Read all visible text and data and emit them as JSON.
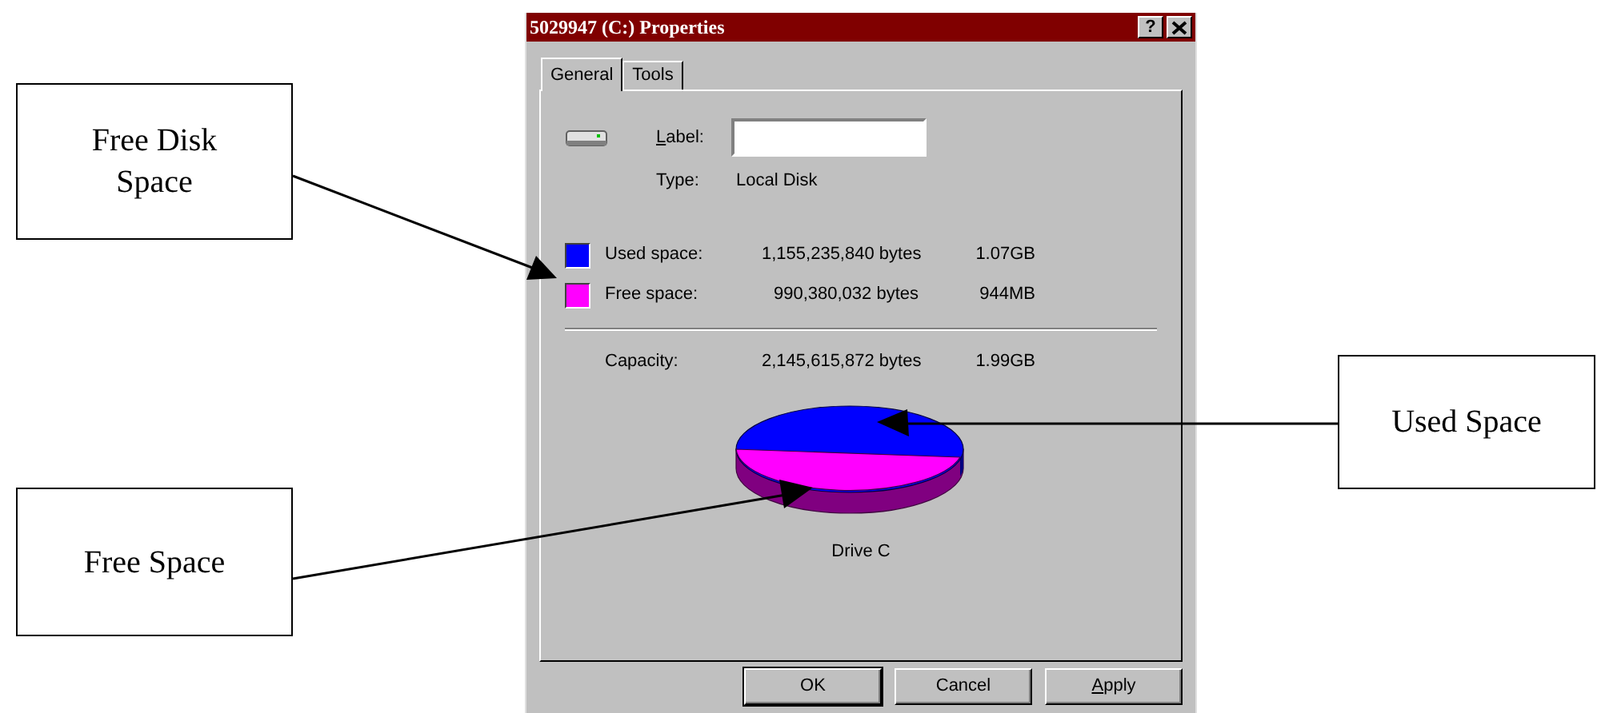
{
  "callouts": [
    {
      "text": "Free Disk Space",
      "kind": "left-top"
    },
    {
      "text": "Used Space",
      "kind": "right"
    },
    {
      "text": "Free Space",
      "kind": "left-bottom"
    }
  ],
  "window": {
    "title": "5029947 (C:) Properties",
    "help_button": "?"
  },
  "tabs": [
    {
      "label": "General",
      "selected": true
    },
    {
      "label": "Tools",
      "selected": false
    }
  ],
  "label_field": {
    "label": "Label:"
  },
  "type": {
    "label": "Type:",
    "value": "Local Disk"
  },
  "space": [
    {
      "label": "Used space:",
      "bytes": "1,155,235,840 bytes",
      "size": "1.07GB",
      "color": "#0000ff"
    },
    {
      "label": "Free space:",
      "bytes": "990,380,032 bytes",
      "size": "944MB",
      "color": "#ff00ff"
    }
  ],
  "capacity": {
    "label": "Capacity:",
    "bytes": "2,145,615,872 bytes",
    "size": "1.99GB"
  },
  "drive_caption": "Drive C",
  "buttons": [
    "OK",
    "Cancel",
    "Apply"
  ]
}
